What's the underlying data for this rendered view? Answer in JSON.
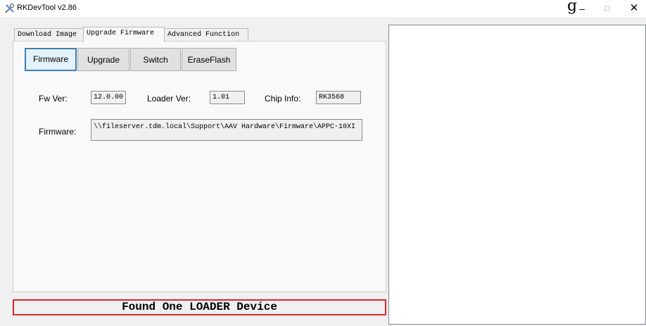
{
  "window": {
    "title": "RKDevTool v2.86",
    "stray_glyph": "g",
    "minimize_glyph": "–",
    "maximize_glyph": "□",
    "close_glyph": "✕"
  },
  "tabs": [
    {
      "label": "Download Image",
      "active": false
    },
    {
      "label": "Upgrade Firmware",
      "active": true
    },
    {
      "label": "Advanced Function",
      "active": false
    }
  ],
  "buttons": {
    "firmware": "Firmware",
    "upgrade": "Upgrade",
    "switch": "Switch",
    "erase_flash": "EraseFlash"
  },
  "info": {
    "fw_ver_label": "Fw Ver:",
    "fw_ver_value": "12.0.00",
    "loader_ver_label": "Loader Ver:",
    "loader_ver_value": "1.01",
    "chip_info_label": "Chip Info:",
    "chip_info_value": "RK3568",
    "firmware_label": "Firmware:",
    "firmware_path": "\\\\fileserver.tdm.local\\Support\\AAV Hardware\\Firmware\\APPC-10XI"
  },
  "status": {
    "message": "Found One LOADER Device",
    "border_color": "#e0242b"
  },
  "colors": {
    "focus_accent": "#3c7fb1"
  }
}
